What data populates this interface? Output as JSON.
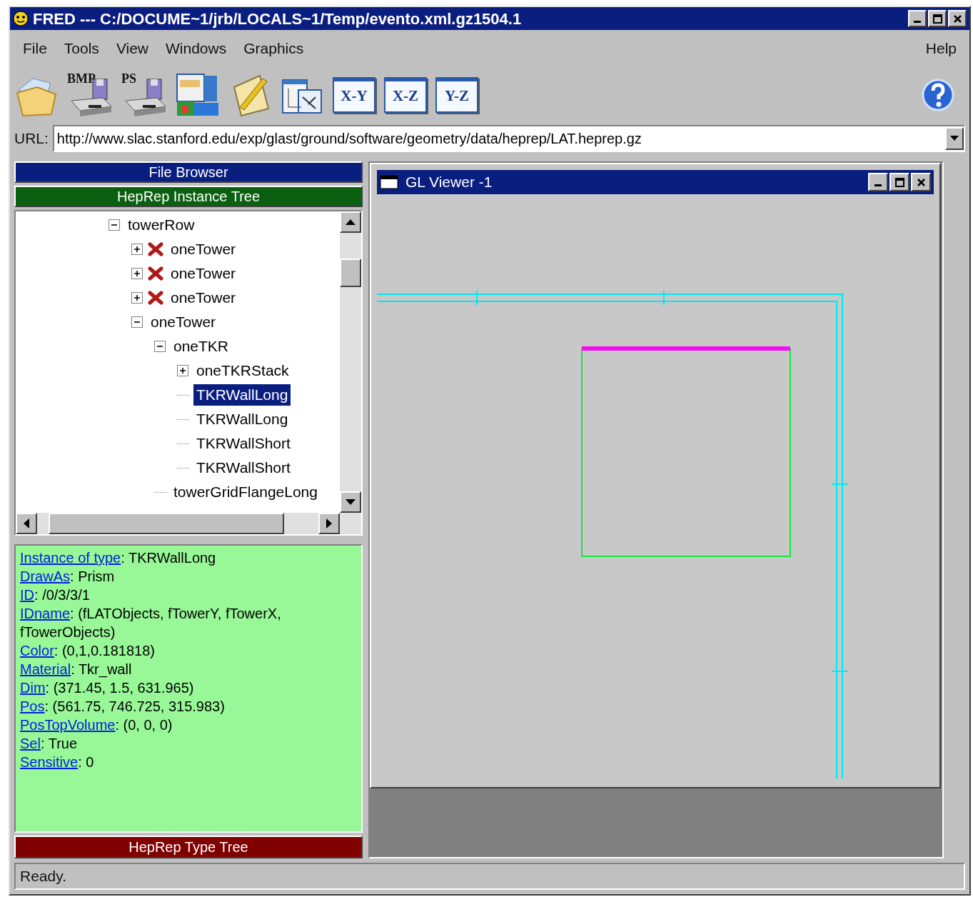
{
  "window": {
    "title": "FRED --- C:/DOCUME~1/jrb/LOCALS~1/Temp/evento.xml.gz1504.1"
  },
  "menu": {
    "left": [
      "File",
      "Tools",
      "View",
      "Windows",
      "Graphics"
    ],
    "right": [
      "Help"
    ]
  },
  "toolbar": [
    {
      "kind": "open"
    },
    {
      "kind": "save",
      "label": "BMP"
    },
    {
      "kind": "save",
      "label": "PS"
    },
    {
      "kind": "layout"
    },
    {
      "kind": "notes"
    },
    {
      "kind": "graphics"
    },
    {
      "kind": "view",
      "label": "X-Y"
    },
    {
      "kind": "view",
      "label": "X-Z"
    },
    {
      "kind": "view",
      "label": "Y-Z"
    }
  ],
  "url": {
    "label": "URL:",
    "value": "http://www.slac.stanford.edu/exp/glast/ground/software/geometry/data/heprep/LAT.heprep.gz"
  },
  "left_panel": {
    "file_browser": "File Browser",
    "instance_tree": {
      "title": "HepRep Instance Tree",
      "items": [
        {
          "label": "towerRow",
          "expanded": true,
          "hidden": false,
          "selected": false,
          "children": [
            {
              "label": "oneTower",
              "expanded": false,
              "hidden": true,
              "selected": false
            },
            {
              "label": "oneTower",
              "expanded": false,
              "hidden": true,
              "selected": false
            },
            {
              "label": "oneTower",
              "expanded": false,
              "hidden": true,
              "selected": false
            },
            {
              "label": "oneTower",
              "expanded": true,
              "hidden": false,
              "selected": false,
              "children": [
                {
                  "label": "oneTKR",
                  "expanded": true,
                  "hidden": false,
                  "selected": false,
                  "children": [
                    {
                      "label": "oneTKRStack",
                      "expanded": false,
                      "hidden": false,
                      "selected": false
                    },
                    {
                      "label": "TKRWallLong",
                      "hidden": false,
                      "selected": true
                    },
                    {
                      "label": "TKRWallLong",
                      "hidden": false,
                      "selected": false
                    },
                    {
                      "label": "TKRWallShort",
                      "hidden": false,
                      "selected": false
                    },
                    {
                      "label": "TKRWallShort",
                      "hidden": false,
                      "selected": false
                    }
                  ]
                },
                {
                  "label": "towerGridFlangeLong",
                  "hidden": false,
                  "selected": false
                }
              ]
            }
          ]
        }
      ]
    },
    "property_separator": ":",
    "properties": [
      {
        "key": "Instance of type",
        "value": "TKRWallLong"
      },
      {
        "key": "DrawAs",
        "value": "Prism"
      },
      {
        "key": "ID",
        "value": "/0/3/3/1"
      },
      {
        "key": "IDname",
        "value": "(fLATObjects, fTowerY, fTowerX, fTowerObjects)"
      },
      {
        "key": "Color",
        "value": "(0,1,0.181818)"
      },
      {
        "key": "Material",
        "value": "Tkr_wall"
      },
      {
        "key": "Dim",
        "value": "(371.45, 1.5, 631.965)"
      },
      {
        "key": "Pos",
        "value": "(561.75, 746.725, 315.983)"
      },
      {
        "key": "PosTopVolume",
        "value": "(0, 0, 0)"
      },
      {
        "key": "Sel",
        "value": "True"
      },
      {
        "key": "Sensitive",
        "value": "0"
      }
    ],
    "type_tree": "HepRep Type Tree"
  },
  "viewer": {
    "title": "GL Viewer -1"
  },
  "status_bar": "Ready."
}
